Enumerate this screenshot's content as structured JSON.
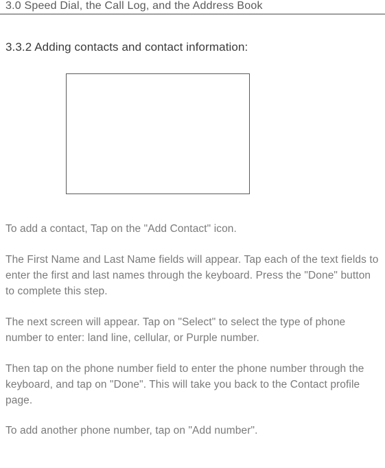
{
  "header": {
    "breadcrumb": "3.0 Speed Dial, the Call Log, and the Address Book"
  },
  "section": {
    "heading": "3.3.2  Adding contacts and contact information:"
  },
  "paragraphs": {
    "p1": "To add a contact, Tap on the \"Add Contact\" icon.",
    "p2": "The First Name and Last Name fields will appear. Tap each of the text fields to enter the first and last names through the keyboard. Press the \"Done\" button to complete this step.",
    "p3": "The next screen will appear. Tap on \"Select\" to select the type of phone number to enter: land line, cellular, or Purple number.",
    "p4": "Then tap on the phone number field to enter the phone number through the keyboard, and tap on \"Done\". This will take you back to the Contact profile page.",
    "p5": "To add another phone number, tap on \"Add number\"."
  }
}
